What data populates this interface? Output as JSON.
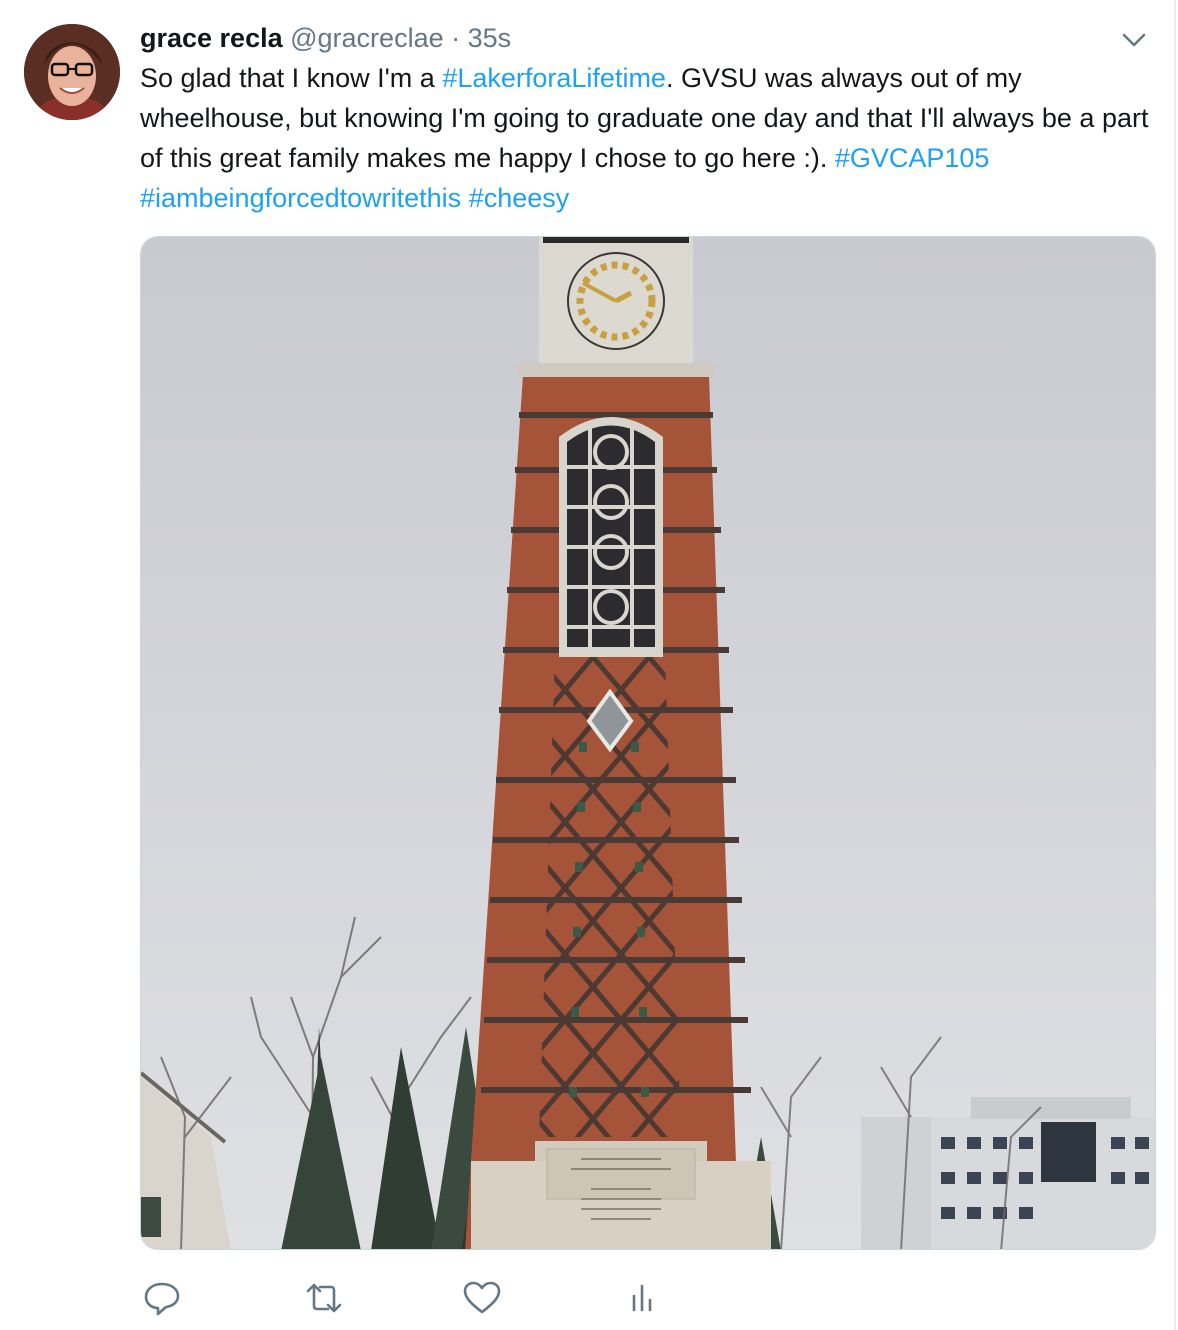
{
  "tweet": {
    "author_name": "grace recla",
    "handle": "@gracreclae",
    "separator": "·",
    "time": "35s",
    "text_parts": [
      {
        "t": "So glad that I know I'm a ",
        "tag": false
      },
      {
        "t": "#LakerforaLifetime",
        "tag": true
      },
      {
        "t": ". GVSU was always out of my wheelhouse, but knowing I'm going to graduate one day and that I'll always be a part of this great family makes me happy I chose to go here :). ",
        "tag": false
      },
      {
        "t": "#GVCAP105",
        "tag": true
      },
      {
        "t": " ",
        "tag": false
      },
      {
        "t": "#iambeingforcedtowritethis",
        "tag": true
      },
      {
        "t": " ",
        "tag": false
      },
      {
        "t": "#cheesy",
        "tag": true
      }
    ]
  },
  "icons": {
    "caret": "chevron-down-icon",
    "reply": "reply-icon",
    "retweet": "retweet-icon",
    "like": "heart-icon",
    "analytics": "analytics-icon"
  },
  "colors": {
    "link": "#1da1f2",
    "secondary": "#657786",
    "brick": "#a0523a",
    "sky": "#cfd0d5"
  }
}
